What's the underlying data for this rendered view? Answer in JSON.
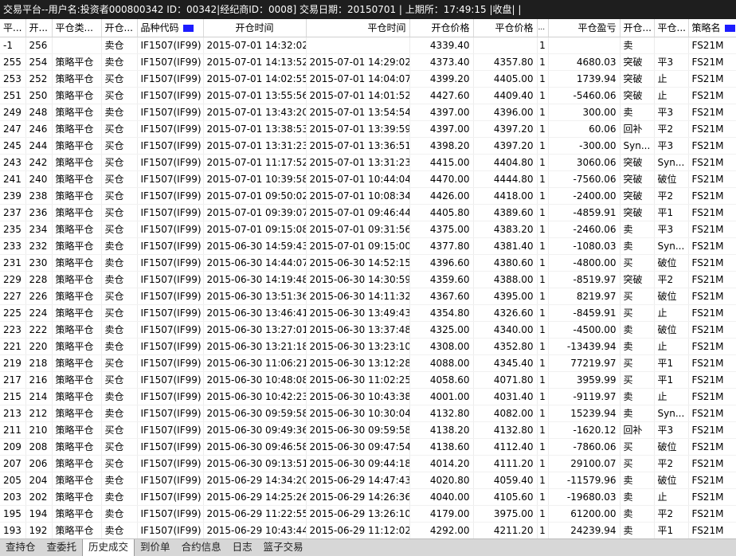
{
  "title_bar": "交易平台--用户名:投资者000800342 ID：00342|经纪商ID：0008]  交易日期：20150701 | 上期所：17:49:15 |收盘| |",
  "columns": [
    {
      "label": "平..."
    },
    {
      "label": "开..."
    },
    {
      "label": "平仓类..."
    },
    {
      "label": "开仓..."
    },
    {
      "label": "品种代码"
    },
    {
      "label": "开仓时间"
    },
    {
      "label": "平仓时间"
    },
    {
      "label": "开仓价格"
    },
    {
      "label": "平仓价格"
    },
    {
      "label": "..."
    },
    {
      "label": "平仓盈亏"
    },
    {
      "label": "开仓..."
    },
    {
      "label": "平仓..."
    },
    {
      "label": "策略名"
    }
  ],
  "rows": [
    [
      "-1",
      "256",
      "",
      "卖仓",
      "IF1507(IF99)",
      "2015-07-01 14:32:02",
      "",
      "4339.40",
      "",
      "1",
      "",
      "卖",
      "",
      "FS21M"
    ],
    [
      "255",
      "254",
      "策略平仓",
      "卖仓",
      "IF1507(IF99)",
      "2015-07-01 14:13:52",
      "2015-07-01 14:29:02",
      "4373.40",
      "4357.80",
      "1",
      "4680.03",
      "突破",
      "平3",
      "FS21M"
    ],
    [
      "253",
      "252",
      "策略平仓",
      "买仓",
      "IF1507(IF99)",
      "2015-07-01 14:02:55",
      "2015-07-01 14:04:07",
      "4399.20",
      "4405.00",
      "1",
      "1739.94",
      "突破",
      "止",
      "FS21M"
    ],
    [
      "251",
      "250",
      "策略平仓",
      "买仓",
      "IF1507(IF99)",
      "2015-07-01 13:55:56",
      "2015-07-01 14:01:52",
      "4427.60",
      "4409.40",
      "1",
      "-5460.06",
      "突破",
      "止",
      "FS21M"
    ],
    [
      "249",
      "248",
      "策略平仓",
      "卖仓",
      "IF1507(IF99)",
      "2015-07-01 13:43:20",
      "2015-07-01 13:54:54",
      "4397.00",
      "4396.00",
      "1",
      "300.00",
      "卖",
      "平3",
      "FS21M"
    ],
    [
      "247",
      "246",
      "策略平仓",
      "买仓",
      "IF1507(IF99)",
      "2015-07-01 13:38:53",
      "2015-07-01 13:39:59",
      "4397.00",
      "4397.20",
      "1",
      "60.06",
      "回补",
      "平2",
      "FS21M"
    ],
    [
      "245",
      "244",
      "策略平仓",
      "买仓",
      "IF1507(IF99)",
      "2015-07-01 13:31:23",
      "2015-07-01 13:36:51",
      "4398.20",
      "4397.20",
      "1",
      "-300.00",
      "Syn...",
      "平3",
      "FS21M"
    ],
    [
      "243",
      "242",
      "策略平仓",
      "买仓",
      "IF1507(IF99)",
      "2015-07-01 11:17:52",
      "2015-07-01 13:31:23",
      "4415.00",
      "4404.80",
      "1",
      "3060.06",
      "突破",
      "Syn...",
      "FS21M"
    ],
    [
      "241",
      "240",
      "策略平仓",
      "买仓",
      "IF1507(IF99)",
      "2015-07-01 10:39:58",
      "2015-07-01 10:44:04",
      "4470.00",
      "4444.80",
      "1",
      "-7560.06",
      "突破",
      "破位",
      "FS21M"
    ],
    [
      "239",
      "238",
      "策略平仓",
      "买仓",
      "IF1507(IF99)",
      "2015-07-01 09:50:02",
      "2015-07-01 10:08:34",
      "4426.00",
      "4418.00",
      "1",
      "-2400.00",
      "突破",
      "平2",
      "FS21M"
    ],
    [
      "237",
      "236",
      "策略平仓",
      "买仓",
      "IF1507(IF99)",
      "2015-07-01 09:39:07",
      "2015-07-01 09:46:44",
      "4405.80",
      "4389.60",
      "1",
      "-4859.91",
      "突破",
      "平1",
      "FS21M"
    ],
    [
      "235",
      "234",
      "策略平仓",
      "买仓",
      "IF1507(IF99)",
      "2015-07-01 09:15:08",
      "2015-07-01 09:31:56",
      "4375.00",
      "4383.20",
      "1",
      "-2460.06",
      "卖",
      "平3",
      "FS21M"
    ],
    [
      "233",
      "232",
      "策略平仓",
      "卖仓",
      "IF1507(IF99)",
      "2015-06-30 14:59:43",
      "2015-07-01 09:15:00",
      "4377.80",
      "4381.40",
      "1",
      "-1080.03",
      "卖",
      "Syn...",
      "FS21M"
    ],
    [
      "231",
      "230",
      "策略平仓",
      "卖仓",
      "IF1507(IF99)",
      "2015-06-30 14:44:07",
      "2015-06-30 14:52:15",
      "4396.60",
      "4380.60",
      "1",
      "-4800.00",
      "买",
      "破位",
      "FS21M"
    ],
    [
      "229",
      "228",
      "策略平仓",
      "卖仓",
      "IF1507(IF99)",
      "2015-06-30 14:19:48",
      "2015-06-30 14:30:59",
      "4359.60",
      "4388.00",
      "1",
      "-8519.97",
      "突破",
      "平2",
      "FS21M"
    ],
    [
      "227",
      "226",
      "策略平仓",
      "买仓",
      "IF1507(IF99)",
      "2015-06-30 13:51:36",
      "2015-06-30 14:11:32",
      "4367.60",
      "4395.00",
      "1",
      "8219.97",
      "买",
      "破位",
      "FS21M"
    ],
    [
      "225",
      "224",
      "策略平仓",
      "买仓",
      "IF1507(IF99)",
      "2015-06-30 13:46:41",
      "2015-06-30 13:49:43",
      "4354.80",
      "4326.60",
      "1",
      "-8459.91",
      "买",
      "止",
      "FS21M"
    ],
    [
      "223",
      "222",
      "策略平仓",
      "卖仓",
      "IF1507(IF99)",
      "2015-06-30 13:27:01",
      "2015-06-30 13:37:48",
      "4325.00",
      "4340.00",
      "1",
      "-4500.00",
      "卖",
      "破位",
      "FS21M"
    ],
    [
      "221",
      "220",
      "策略平仓",
      "卖仓",
      "IF1507(IF99)",
      "2015-06-30 13:21:18",
      "2015-06-30 13:23:10",
      "4308.00",
      "4352.80",
      "1",
      "-13439.94",
      "卖",
      "止",
      "FS21M"
    ],
    [
      "219",
      "218",
      "策略平仓",
      "买仓",
      "IF1507(IF99)",
      "2015-06-30 11:06:21",
      "2015-06-30 13:12:28",
      "4088.00",
      "4345.40",
      "1",
      "77219.97",
      "买",
      "平1",
      "FS21M"
    ],
    [
      "217",
      "216",
      "策略平仓",
      "买仓",
      "IF1507(IF99)",
      "2015-06-30 10:48:08",
      "2015-06-30 11:02:25",
      "4058.60",
      "4071.80",
      "1",
      "3959.99",
      "买",
      "平1",
      "FS21M"
    ],
    [
      "215",
      "214",
      "策略平仓",
      "卖仓",
      "IF1507(IF99)",
      "2015-06-30 10:42:23",
      "2015-06-30 10:43:38",
      "4001.00",
      "4031.40",
      "1",
      "-9119.97",
      "卖",
      "止",
      "FS21M"
    ],
    [
      "213",
      "212",
      "策略平仓",
      "卖仓",
      "IF1507(IF99)",
      "2015-06-30 09:59:58",
      "2015-06-30 10:30:04",
      "4132.80",
      "4082.00",
      "1",
      "15239.94",
      "卖",
      "Syn...",
      "FS21M"
    ],
    [
      "211",
      "210",
      "策略平仓",
      "买仓",
      "IF1507(IF99)",
      "2015-06-30 09:49:36",
      "2015-06-30 09:59:58",
      "4138.20",
      "4132.80",
      "1",
      "-1620.12",
      "回补",
      "平3",
      "FS21M"
    ],
    [
      "209",
      "208",
      "策略平仓",
      "买仓",
      "IF1507(IF99)",
      "2015-06-30 09:46:58",
      "2015-06-30 09:47:54",
      "4138.60",
      "4112.40",
      "1",
      "-7860.06",
      "买",
      "破位",
      "FS21M"
    ],
    [
      "207",
      "206",
      "策略平仓",
      "买仓",
      "IF1507(IF99)",
      "2015-06-30 09:13:51",
      "2015-06-30 09:44:18",
      "4014.20",
      "4111.20",
      "1",
      "29100.07",
      "买",
      "平2",
      "FS21M"
    ],
    [
      "205",
      "204",
      "策略平仓",
      "卖仓",
      "IF1507(IF99)",
      "2015-06-29 14:34:20",
      "2015-06-29 14:47:43",
      "4020.80",
      "4059.40",
      "1",
      "-11579.96",
      "卖",
      "破位",
      "FS21M"
    ],
    [
      "203",
      "202",
      "策略平仓",
      "卖仓",
      "IF1507(IF99)",
      "2015-06-29 14:25:26",
      "2015-06-29 14:26:36",
      "4040.00",
      "4105.60",
      "1",
      "-19680.03",
      "卖",
      "止",
      "FS21M"
    ],
    [
      "195",
      "194",
      "策略平仓",
      "卖仓",
      "IF1507(IF99)",
      "2015-06-29 11:22:55",
      "2015-06-29 13:26:10",
      "4179.00",
      "3975.00",
      "1",
      "61200.00",
      "卖",
      "平2",
      "FS21M"
    ],
    [
      "193",
      "192",
      "策略平仓",
      "卖仓",
      "IF1507(IF99)",
      "2015-06-29 10:43:44",
      "2015-06-29 11:12:02",
      "4292.00",
      "4211.20",
      "1",
      "24239.94",
      "卖",
      "平1",
      "FS21M"
    ]
  ],
  "tabs": [
    {
      "label": "查持仓",
      "active": false
    },
    {
      "label": "查委托",
      "active": false
    },
    {
      "label": "历史成交",
      "active": true
    },
    {
      "label": "到价单",
      "active": false
    },
    {
      "label": "合约信息",
      "active": false
    },
    {
      "label": "日志",
      "active": false
    },
    {
      "label": "篮子交易",
      "active": false
    }
  ],
  "colors": {
    "title_bg": "#1e1e1e",
    "header_marker": "#1c1cff",
    "tab_bar_bg": "#d7d7d7"
  }
}
